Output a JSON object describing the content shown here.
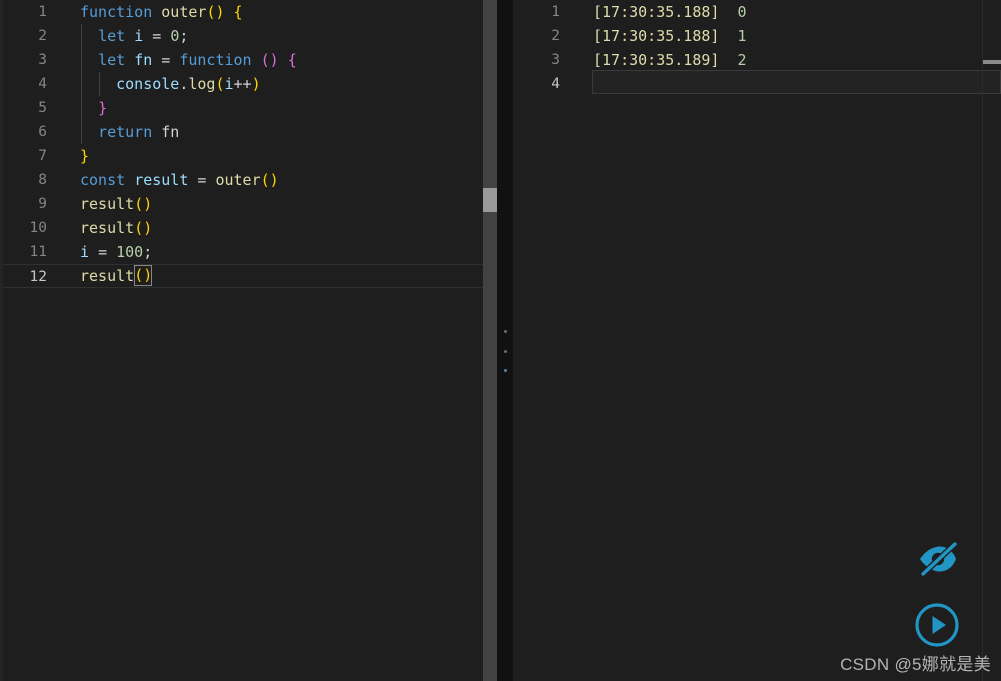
{
  "editor": {
    "language": "javascript",
    "cursor_line": 12,
    "lines": [
      {
        "n": "1",
        "indent": 0,
        "tokens": [
          {
            "t": "function",
            "c": "t-kw"
          },
          {
            "t": " ",
            "c": "t-plain"
          },
          {
            "t": "outer",
            "c": "t-fn"
          },
          {
            "t": "()",
            "c": "t-paren1"
          },
          {
            "t": " ",
            "c": "t-plain"
          },
          {
            "t": "{",
            "c": "t-paren1"
          }
        ]
      },
      {
        "n": "2",
        "indent": 1,
        "tokens": [
          {
            "t": "  ",
            "c": "t-plain"
          },
          {
            "t": "let",
            "c": "t-kw"
          },
          {
            "t": " ",
            "c": "t-plain"
          },
          {
            "t": "i",
            "c": "t-var"
          },
          {
            "t": " ",
            "c": "t-plain"
          },
          {
            "t": "=",
            "c": "t-op"
          },
          {
            "t": " ",
            "c": "t-plain"
          },
          {
            "t": "0",
            "c": "t-num"
          },
          {
            "t": ";",
            "c": "t-punc"
          }
        ]
      },
      {
        "n": "3",
        "indent": 1,
        "tokens": [
          {
            "t": "  ",
            "c": "t-plain"
          },
          {
            "t": "let",
            "c": "t-kw"
          },
          {
            "t": " ",
            "c": "t-plain"
          },
          {
            "t": "fn",
            "c": "t-var"
          },
          {
            "t": " ",
            "c": "t-plain"
          },
          {
            "t": "=",
            "c": "t-op"
          },
          {
            "t": " ",
            "c": "t-plain"
          },
          {
            "t": "function",
            "c": "t-kw"
          },
          {
            "t": " ",
            "c": "t-plain"
          },
          {
            "t": "()",
            "c": "t-paren2"
          },
          {
            "t": " ",
            "c": "t-plain"
          },
          {
            "t": "{",
            "c": "t-paren2"
          }
        ]
      },
      {
        "n": "4",
        "indent": 2,
        "tokens": [
          {
            "t": "    ",
            "c": "t-plain"
          },
          {
            "t": "console",
            "c": "t-var"
          },
          {
            "t": ".",
            "c": "t-punc"
          },
          {
            "t": "log",
            "c": "t-fn"
          },
          {
            "t": "(",
            "c": "t-paren1"
          },
          {
            "t": "i",
            "c": "t-var"
          },
          {
            "t": "++",
            "c": "t-op"
          },
          {
            "t": ")",
            "c": "t-paren1"
          }
        ]
      },
      {
        "n": "5",
        "indent": 1,
        "tokens": [
          {
            "t": "  ",
            "c": "t-plain"
          },
          {
            "t": "}",
            "c": "t-paren2"
          }
        ]
      },
      {
        "n": "6",
        "indent": 1,
        "tokens": [
          {
            "t": "  ",
            "c": "t-plain"
          },
          {
            "t": "return",
            "c": "t-kw"
          },
          {
            "t": " ",
            "c": "t-plain"
          },
          {
            "t": "fn",
            "c": "t-plain"
          }
        ]
      },
      {
        "n": "7",
        "indent": 0,
        "tokens": [
          {
            "t": "}",
            "c": "t-paren1"
          }
        ]
      },
      {
        "n": "8",
        "indent": 0,
        "tokens": [
          {
            "t": "const",
            "c": "t-kw"
          },
          {
            "t": " ",
            "c": "t-plain"
          },
          {
            "t": "result",
            "c": "t-var"
          },
          {
            "t": " ",
            "c": "t-plain"
          },
          {
            "t": "=",
            "c": "t-op"
          },
          {
            "t": " ",
            "c": "t-plain"
          },
          {
            "t": "outer",
            "c": "t-fn"
          },
          {
            "t": "()",
            "c": "t-paren1"
          }
        ]
      },
      {
        "n": "9",
        "indent": 0,
        "tokens": [
          {
            "t": "result",
            "c": "t-fn"
          },
          {
            "t": "()",
            "c": "t-paren1"
          }
        ]
      },
      {
        "n": "10",
        "indent": 0,
        "tokens": [
          {
            "t": "result",
            "c": "t-fn"
          },
          {
            "t": "()",
            "c": "t-paren1"
          }
        ]
      },
      {
        "n": "11",
        "indent": 0,
        "tokens": [
          {
            "t": "i",
            "c": "t-var"
          },
          {
            "t": " ",
            "c": "t-plain"
          },
          {
            "t": "=",
            "c": "t-op"
          },
          {
            "t": " ",
            "c": "t-plain"
          },
          {
            "t": "100",
            "c": "t-num"
          },
          {
            "t": ";",
            "c": "t-punc"
          }
        ]
      },
      {
        "n": "12",
        "indent": 0,
        "active": true,
        "tokens": [
          {
            "t": "result",
            "c": "t-fn"
          },
          {
            "t": "()",
            "c": "t-paren1",
            "match": true
          }
        ]
      }
    ]
  },
  "output": {
    "active_line": 4,
    "lines": [
      {
        "n": "1",
        "time": "[17:30:35.188]",
        "value": "0"
      },
      {
        "n": "2",
        "time": "[17:30:35.188]",
        "value": "1"
      },
      {
        "n": "3",
        "time": "[17:30:35.189]",
        "value": "2"
      },
      {
        "n": "4",
        "time": "",
        "value": ""
      }
    ]
  },
  "actions": {
    "accent_color": "#2196c4",
    "buttons": [
      {
        "name": "hide-output-icon",
        "label": "eye-off"
      },
      {
        "name": "run-code-icon",
        "label": "run"
      }
    ]
  },
  "watermark": {
    "text": "CSDN @5娜就是美"
  },
  "colors": {
    "editor_bg": "#1e1e1e",
    "scrollbar": "#424242",
    "scrollbar_thumb": "#9a9a9a",
    "gutter_text": "#858585",
    "keyword": "#569cd6",
    "function": "#dcdcaa",
    "variable": "#9cdcfe",
    "number": "#b5cea8",
    "bracket_1": "#ffd700",
    "bracket_2": "#da70d6",
    "accent": "#2196c4"
  }
}
